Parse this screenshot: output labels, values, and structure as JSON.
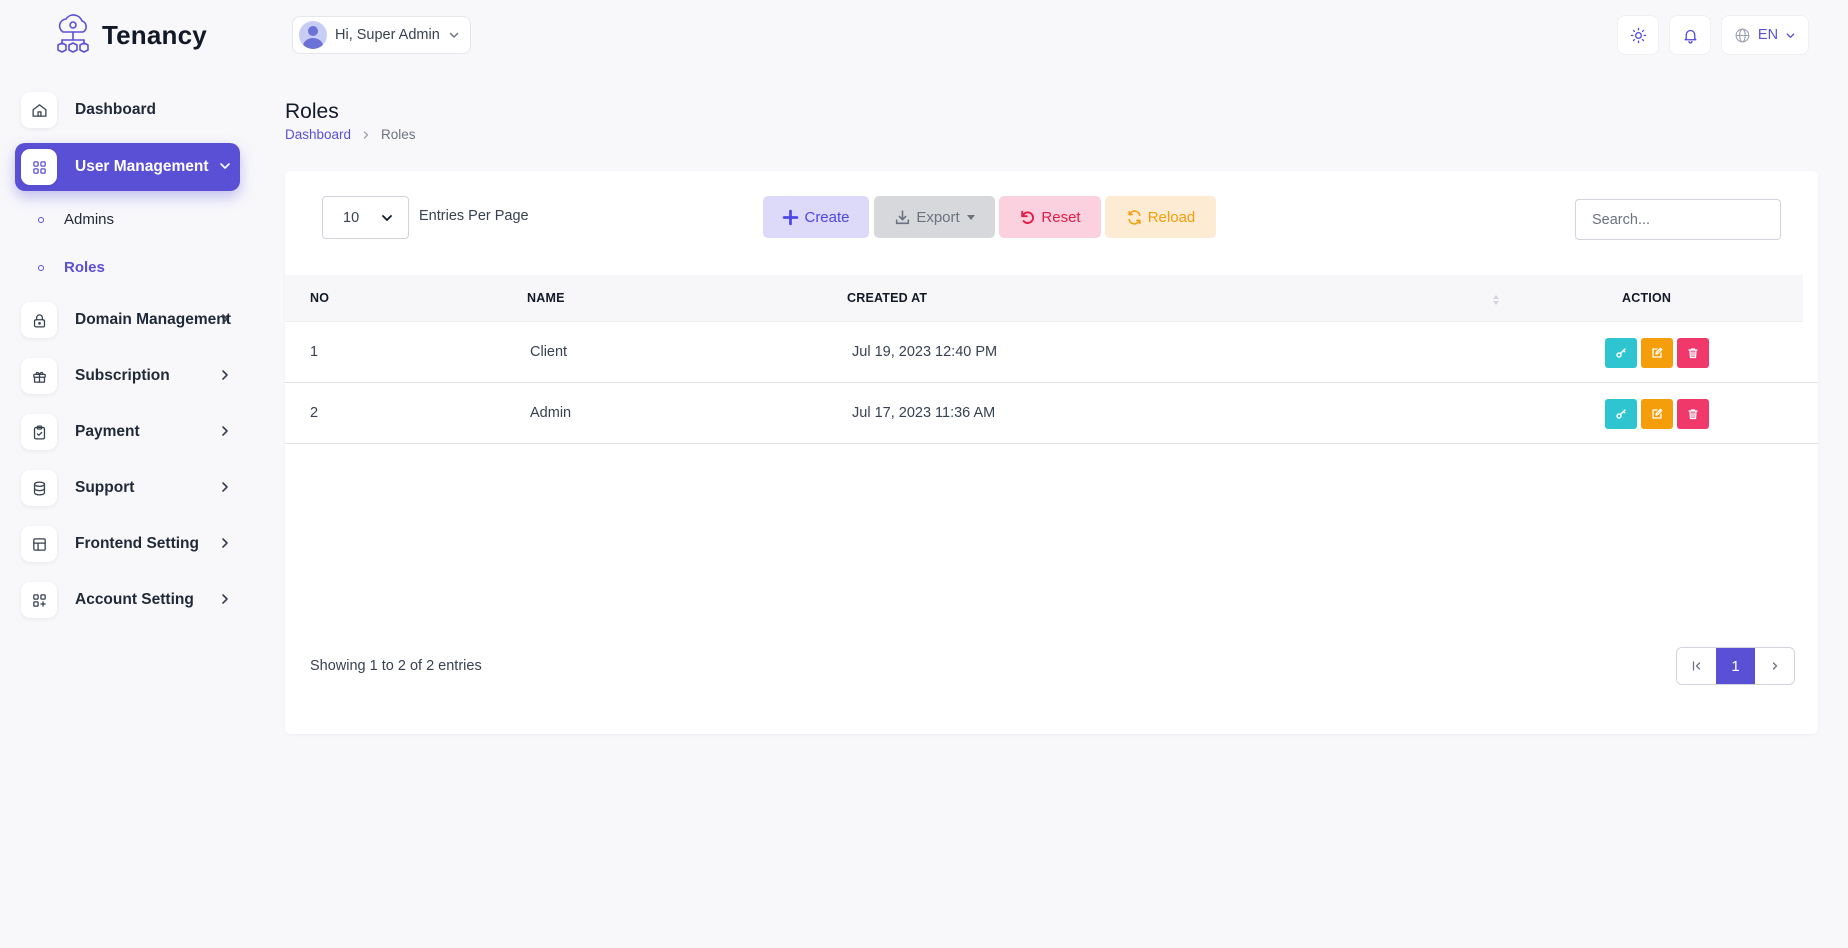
{
  "app": {
    "name": "Tenancy"
  },
  "sidebar": {
    "items": [
      {
        "label": "Dashboard",
        "icon": "home-icon"
      },
      {
        "label": "User Management",
        "icon": "grid-icon",
        "active": true
      },
      {
        "label": "Domain Management",
        "icon": "lock-icon"
      },
      {
        "label": "Subscription",
        "icon": "gift-icon"
      },
      {
        "label": "Payment",
        "icon": "clipboard-check-icon"
      },
      {
        "label": "Support",
        "icon": "database-icon"
      },
      {
        "label": "Frontend Setting",
        "icon": "table-icon"
      },
      {
        "label": "Account Setting",
        "icon": "apps-add-icon"
      }
    ],
    "sub_items": [
      {
        "label": "Admins"
      },
      {
        "label": "Roles",
        "active": true
      }
    ]
  },
  "topbar": {
    "greeting": "Hi, Super Admin",
    "language": "EN"
  },
  "page": {
    "title": "Roles",
    "breadcrumb": [
      "Dashboard",
      "Roles"
    ]
  },
  "toolbar": {
    "entries_value": "10",
    "entries_label": "Entries Per Page",
    "create_label": "Create",
    "export_label": "Export",
    "reset_label": "Reset",
    "reload_label": "Reload",
    "search_placeholder": "Search..."
  },
  "table": {
    "columns": [
      "NO",
      "NAME",
      "CREATED AT",
      "ACTION"
    ],
    "rows": [
      {
        "no": "1",
        "name": "Client",
        "created_at": "Jul 19, 2023 12:40 PM"
      },
      {
        "no": "2",
        "name": "Admin",
        "created_at": "Jul 17, 2023 11:36 AM"
      }
    ]
  },
  "footer": {
    "showing": "Showing 1 to 2 of 2 entries",
    "current_page": "1"
  },
  "colors": {
    "accent": "#5a50d6",
    "key_button": "#2ec5d0",
    "edit_button": "#f59e0b",
    "delete_button": "#f0386b"
  }
}
